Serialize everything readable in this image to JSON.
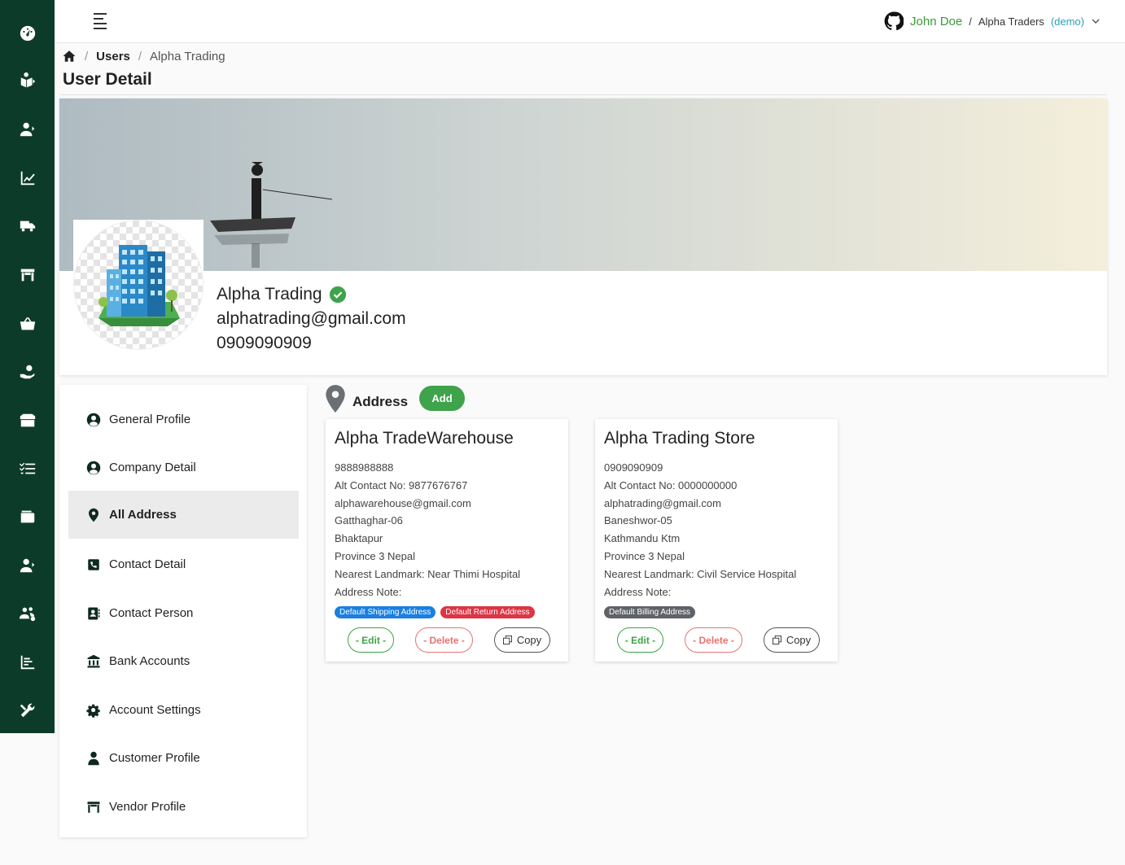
{
  "topbar": {
    "user_name": "John Doe",
    "separator": "/",
    "company": "Alpha Traders",
    "demo_label": "(demo)"
  },
  "breadcrumb": {
    "separator": "/",
    "users": "Users",
    "current": "Alpha Trading"
  },
  "page": {
    "title": "User Detail"
  },
  "profile": {
    "name": "Alpha Trading",
    "email": "alphatrading@gmail.com",
    "phone": "0909090909"
  },
  "rail_icons": [
    "dashboard-icon",
    "book-icon",
    "user-arrow-icon",
    "chart-line-icon",
    "truck-icon",
    "store-icon",
    "basket-icon",
    "hand-money-icon",
    "box-icon",
    "checklist-icon",
    "wallet-icon",
    "user-tie-icon",
    "users-gear-icon",
    "bar-list-icon",
    "tools-icon"
  ],
  "side_menu": {
    "items": [
      {
        "label": "General Profile",
        "icon": "user-circle-icon"
      },
      {
        "label": "Company Detail",
        "icon": "user-circle-icon"
      },
      {
        "label": "All Address",
        "icon": "map-pin-icon"
      },
      {
        "label": "Contact Detail",
        "icon": "phone-square-icon"
      },
      {
        "label": "Contact Person",
        "icon": "address-book-icon"
      },
      {
        "label": "Bank Accounts",
        "icon": "bank-icon"
      },
      {
        "label": "Account Settings",
        "icon": "gear-icon"
      },
      {
        "label": "Customer Profile",
        "icon": "user-icon"
      },
      {
        "label": "Vendor Profile",
        "icon": "store-icon"
      }
    ],
    "active_index": 2
  },
  "address_section": {
    "title": "Address",
    "add_label": "Add",
    "edit_label": "- Edit -",
    "delete_label": "- Delete -",
    "copy_label": "Copy",
    "cards": [
      {
        "name": "Alpha TradeWarehouse",
        "phone": "9888988888",
        "alt_contact": "Alt Contact No: 9877676767",
        "email": "alphawarehouse@gmail.com",
        "line1": "Gatthaghar-06",
        "line2": "Bhaktapur",
        "province": "Province 3 Nepal",
        "landmark": "Nearest Landmark: Near Thimi Hospital",
        "note": "Address Note:",
        "badges": [
          {
            "text": "Default Shipping Address",
            "color": "#1a7fe0"
          },
          {
            "text": "Default Return Address",
            "color": "#dc3545"
          }
        ]
      },
      {
        "name": "Alpha Trading Store",
        "phone": "0909090909",
        "alt_contact": "Alt Contact No: 0000000000",
        "email": "alphatrading@gmail.com",
        "line1": "Baneshwor-05",
        "line2": "Kathmandu Ktm",
        "province": "Province 3 Nepal",
        "landmark": "Nearest Landmark: Civil Service Hospital",
        "note": "Address Note:",
        "badges": [
          {
            "text": "Default Billing Address",
            "color": "#5f6368"
          }
        ]
      }
    ]
  },
  "colors": {
    "rail": "#0d3b2a",
    "accent_green": "#3ea34a",
    "danger": "#dc3545",
    "primary": "#1a7fe0"
  }
}
